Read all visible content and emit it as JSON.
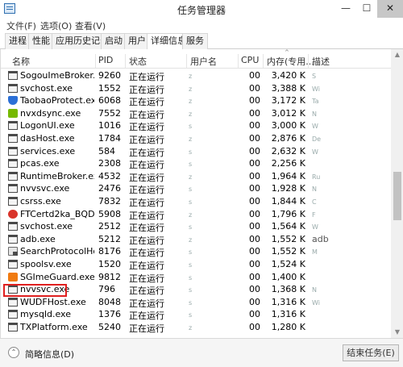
{
  "window": {
    "title": "任务管理器",
    "minimize": "—",
    "maximize": "☐",
    "close": "✕"
  },
  "menu": [
    {
      "label": "文件(F)"
    },
    {
      "label": "选项(O)"
    },
    {
      "label": "查看(V)"
    }
  ],
  "tabs": [
    {
      "label": "进程"
    },
    {
      "label": "性能"
    },
    {
      "label": "应用历史记录"
    },
    {
      "label": "启动"
    },
    {
      "label": "用户"
    },
    {
      "label": "详细信息",
      "active": true
    },
    {
      "label": "服务"
    }
  ],
  "columns": {
    "name": "名称",
    "pid": "PID",
    "status": "状态",
    "user": "用户名",
    "cpu": "CPU",
    "memory": "内存(专用...",
    "description": "描述",
    "sort_arrow": "^"
  },
  "processes": [
    {
      "icon": "window-icon",
      "name": "SogouImeBroker.e...",
      "pid": "9260",
      "status": "正在运行",
      "user": "z",
      "cpu": "00",
      "memory": "3,420 K",
      "description": "S"
    },
    {
      "icon": "window-icon",
      "name": "svchost.exe",
      "pid": "1552",
      "status": "正在运行",
      "user": "z",
      "cpu": "00",
      "memory": "3,388 K",
      "description": "Wi"
    },
    {
      "icon": "taobao-shield-icon",
      "name": "TaobaoProtect.exe",
      "pid": "6068",
      "status": "正在运行",
      "user": "z",
      "cpu": "00",
      "memory": "3,172 K",
      "description": "Ta"
    },
    {
      "icon": "nvidia-icon",
      "name": "nvxdsync.exe",
      "pid": "7552",
      "status": "正在运行",
      "user": "z",
      "cpu": "00",
      "memory": "3,012 K",
      "description": "N"
    },
    {
      "icon": "window-icon",
      "name": "LogonUI.exe",
      "pid": "1016",
      "status": "正在运行",
      "user": "s",
      "cpu": "00",
      "memory": "3,000 K",
      "description": "W"
    },
    {
      "icon": "window-icon",
      "name": "dasHost.exe",
      "pid": "1784",
      "status": "正在运行",
      "user": "z",
      "cpu": "00",
      "memory": "2,876 K",
      "description": "De"
    },
    {
      "icon": "window-icon",
      "name": "services.exe",
      "pid": "584",
      "status": "正在运行",
      "user": "s",
      "cpu": "00",
      "memory": "2,632 K",
      "description": "W"
    },
    {
      "icon": "window-icon",
      "name": "pcas.exe",
      "pid": "2308",
      "status": "正在运行",
      "user": "s",
      "cpu": "00",
      "memory": "2,256 K",
      "description": ""
    },
    {
      "icon": "window-icon",
      "name": "RuntimeBroker.exe",
      "pid": "4532",
      "status": "正在运行",
      "user": "z",
      "cpu": "00",
      "memory": "1,964 K",
      "description": "Ru"
    },
    {
      "icon": "window-icon",
      "name": "nvvsvc.exe",
      "pid": "2476",
      "status": "正在运行",
      "user": "s",
      "cpu": "00",
      "memory": "1,928 K",
      "description": "N"
    },
    {
      "icon": "window-icon",
      "name": "csrss.exe",
      "pid": "7832",
      "status": "正在运行",
      "user": "s",
      "cpu": "00",
      "memory": "1,844 K",
      "description": "C"
    },
    {
      "icon": "ftcert-icon",
      "name": "FTCertd2ka_BQD.e...",
      "pid": "5908",
      "status": "正在运行",
      "user": "z",
      "cpu": "00",
      "memory": "1,796 K",
      "description": "F"
    },
    {
      "icon": "window-icon",
      "name": "svchost.exe",
      "pid": "2512",
      "status": "正在运行",
      "user": "s",
      "cpu": "00",
      "memory": "1,564 K",
      "description": "W"
    },
    {
      "icon": "window-icon",
      "name": "adb.exe",
      "pid": "5212",
      "status": "正在运行",
      "user": "z",
      "cpu": "00",
      "memory": "1,552 K",
      "description": "adb"
    },
    {
      "icon": "search-protocol-icon",
      "name": "SearchProtocolHo...",
      "pid": "8176",
      "status": "正在运行",
      "user": "s",
      "cpu": "00",
      "memory": "1,552 K",
      "description": "M"
    },
    {
      "icon": "window-icon",
      "name": "spoolsv.exe",
      "pid": "1520",
      "status": "正在运行",
      "user": "s",
      "cpu": "00",
      "memory": "1,524 K",
      "description": ""
    },
    {
      "icon": "sogou-ime-icon",
      "name": "SGImeGuard.exe",
      "pid": "9812",
      "status": "正在运行",
      "user": "s",
      "cpu": "00",
      "memory": "1,400 K",
      "description": ""
    },
    {
      "icon": "window-icon",
      "name": "nvvsvc.exe",
      "pid": "796",
      "status": "正在运行",
      "user": "s",
      "cpu": "00",
      "memory": "1,368 K",
      "description": "N"
    },
    {
      "icon": "window-icon",
      "name": "WUDFHost.exe",
      "pid": "8048",
      "status": "正在运行",
      "user": "s",
      "cpu": "00",
      "memory": "1,316 K",
      "description": "Wi"
    },
    {
      "icon": "window-icon",
      "name": "mysqld.exe",
      "pid": "1376",
      "status": "正在运行",
      "user": "s",
      "cpu": "00",
      "memory": "1,316 K",
      "description": ""
    },
    {
      "icon": "window-icon",
      "name": "TXPlatform.exe",
      "pid": "5240",
      "status": "正在运行",
      "user": "z",
      "cpu": "00",
      "memory": "1,280 K",
      "description": ""
    }
  ],
  "highlighted_process": "adb.exe",
  "footer": {
    "collapse_label": "简略信息(D)",
    "end_task_label": "结束任务(E)",
    "collapse_glyph": "⌃"
  },
  "colors": {
    "highlight": "#e02020",
    "scrollbar_thumb": "#c2c2c2"
  }
}
